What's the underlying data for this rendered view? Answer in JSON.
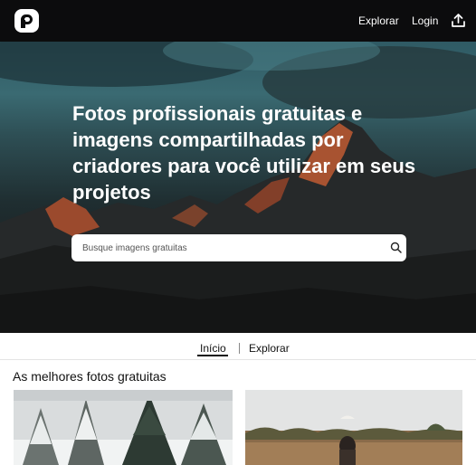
{
  "header": {
    "logo_icon": "pexels-logo-icon",
    "nav": {
      "explore_label": "Explorar",
      "login_label": "Login"
    },
    "upload_icon": "upload-icon"
  },
  "hero": {
    "title": "Fotos profissionais gratuitas e imagens compartilhadas por criadores para você utilizar em seus projetos",
    "search": {
      "placeholder": "Busque imagens gratuitas",
      "icon": "search-icon"
    }
  },
  "tabs": {
    "items": [
      {
        "label": "Início",
        "active": true
      },
      {
        "label": "Explorar",
        "active": false
      }
    ]
  },
  "main": {
    "section_title": "As melhores fotos gratuitas"
  },
  "colors": {
    "header_bg": "#0c0c0d",
    "accent": "#ffffff"
  }
}
